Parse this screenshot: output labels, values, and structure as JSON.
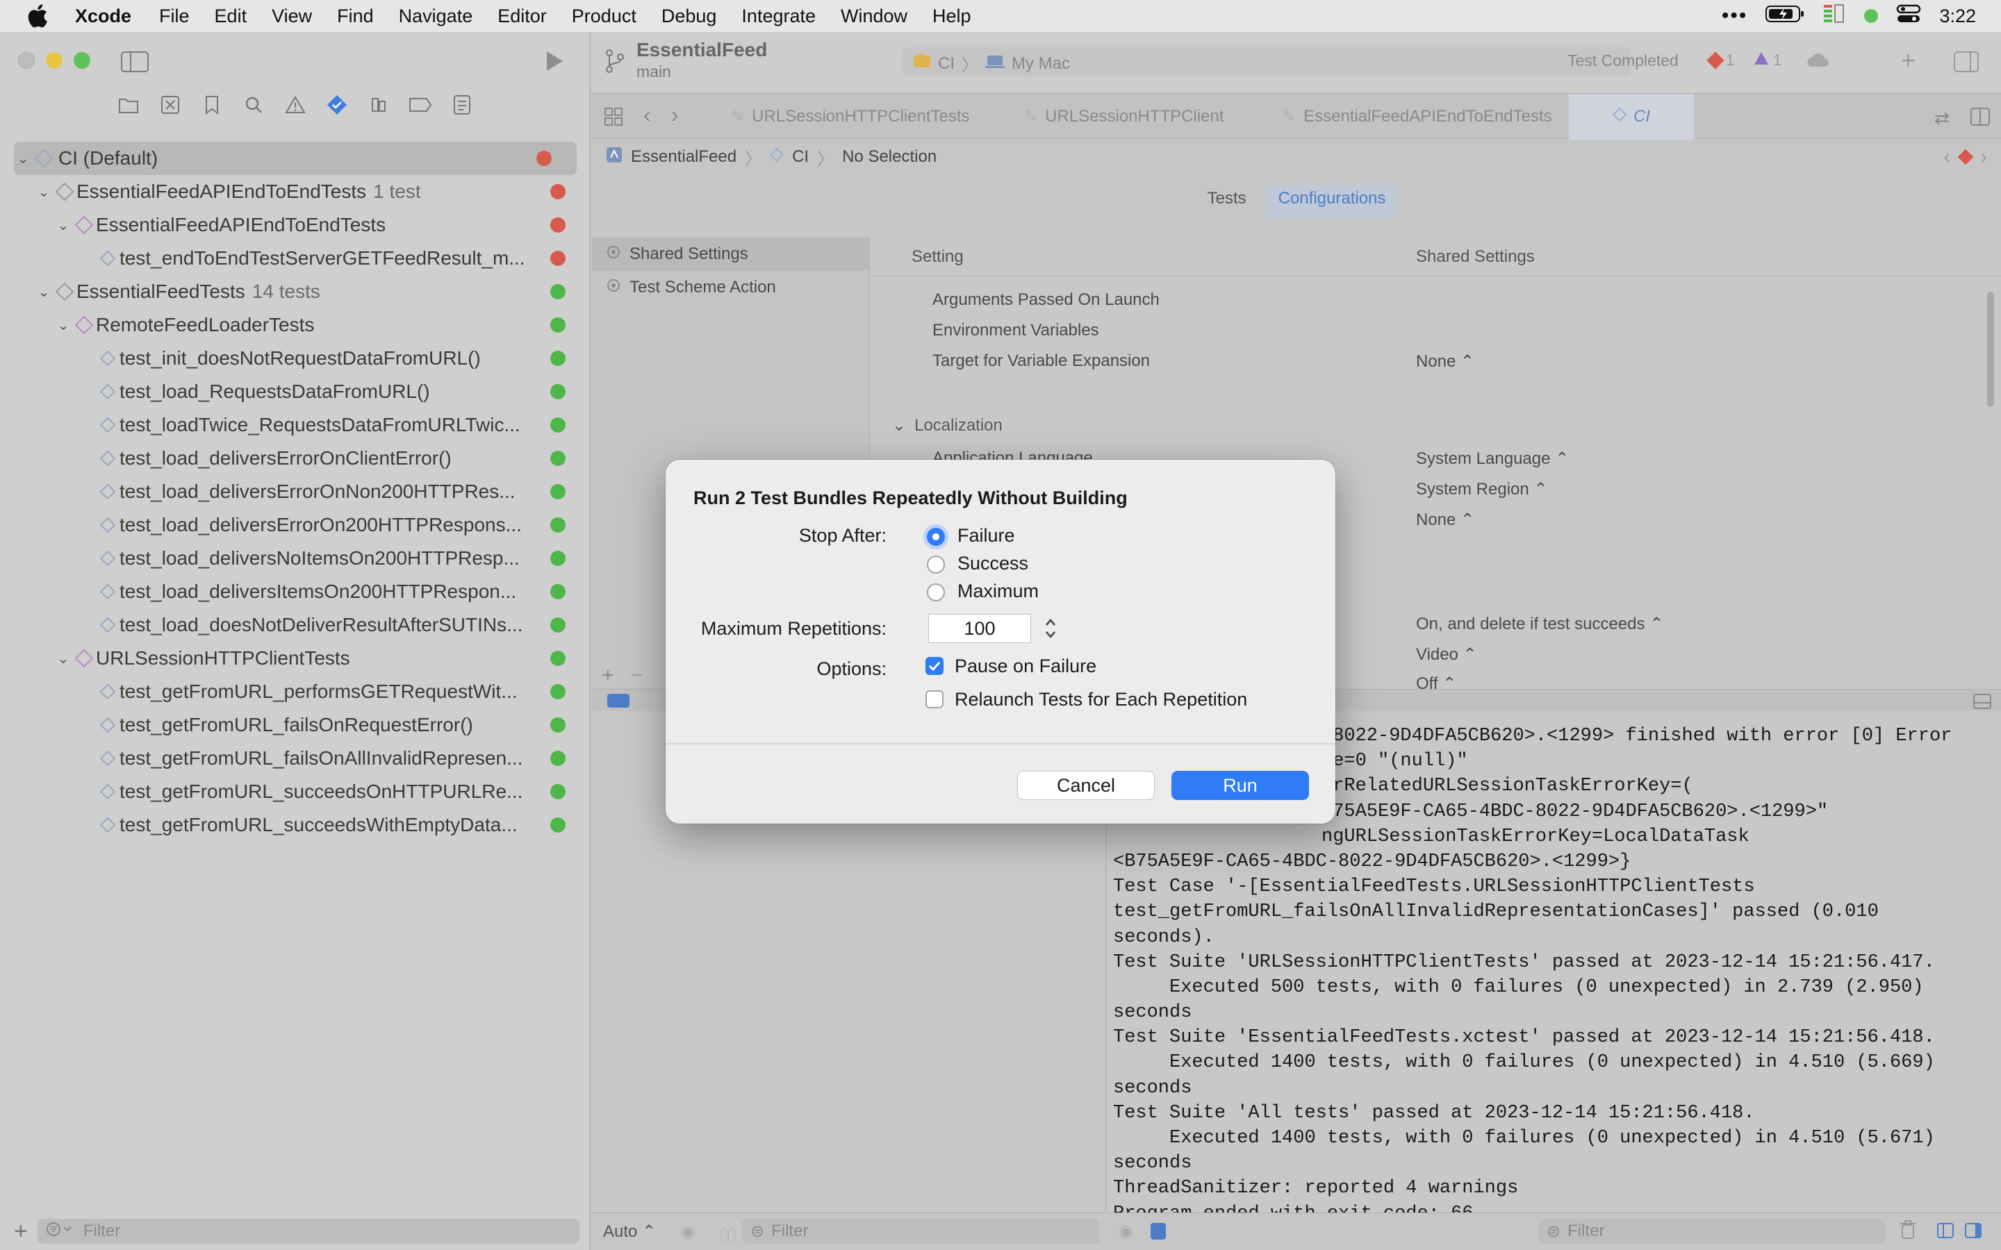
{
  "menubar": {
    "app": "Xcode",
    "items": [
      "File",
      "Edit",
      "View",
      "Find",
      "Navigate",
      "Editor",
      "Product",
      "Debug",
      "Integrate",
      "Window",
      "Help"
    ],
    "clock": "3:22"
  },
  "toolbar": {
    "project": "EssentialFeed",
    "branch": "main",
    "scheme": "CI",
    "destination": "My Mac",
    "status": "Test Completed",
    "errors": "1",
    "warnings": "1"
  },
  "navigator": {
    "rows": [
      {
        "label": "CI (Default)",
        "count": "",
        "status": "fail"
      },
      {
        "label": "EssentialFeedAPIEndToEndTests",
        "count": "1 test",
        "status": "fail"
      },
      {
        "label": "EssentialFeedAPIEndToEndTests",
        "count": "",
        "status": "fail"
      },
      {
        "label": "test_endToEndTestServerGETFeedResult_m...",
        "count": "",
        "status": "fail"
      },
      {
        "label": "EssentialFeedTests",
        "count": "14 tests",
        "status": "pass"
      },
      {
        "label": "RemoteFeedLoaderTests",
        "count": "",
        "status": "pass"
      },
      {
        "label": "test_init_doesNotRequestDataFromURL()",
        "count": "",
        "status": "pass"
      },
      {
        "label": "test_load_RequestsDataFromURL()",
        "count": "",
        "status": "pass"
      },
      {
        "label": "test_loadTwice_RequestsDataFromURLTwic...",
        "count": "",
        "status": "pass"
      },
      {
        "label": "test_load_deliversErrorOnClientError()",
        "count": "",
        "status": "pass"
      },
      {
        "label": "test_load_deliversErrorOnNon200HTTPRes...",
        "count": "",
        "status": "pass"
      },
      {
        "label": "test_load_deliversErrorOn200HTTPRespons...",
        "count": "",
        "status": "pass"
      },
      {
        "label": "test_load_deliversNoItemsOn200HTTPResp...",
        "count": "",
        "status": "pass"
      },
      {
        "label": "test_load_deliversItemsOn200HTTPRespon...",
        "count": "",
        "status": "pass"
      },
      {
        "label": "test_load_doesNotDeliverResultAfterSUTINs...",
        "count": "",
        "status": "pass"
      },
      {
        "label": "URLSessionHTTPClientTests",
        "count": "",
        "status": "pass"
      },
      {
        "label": "test_getFromURL_performsGETRequestWit...",
        "count": "",
        "status": "pass"
      },
      {
        "label": "test_getFromURL_failsOnRequestError()",
        "count": "",
        "status": "pass"
      },
      {
        "label": "test_getFromURL_failsOnAllInvalidRepresen...",
        "count": "",
        "status": "pass"
      },
      {
        "label": "test_getFromURL_succeedsOnHTTPURLRe...",
        "count": "",
        "status": "pass"
      },
      {
        "label": "test_getFromURL_succeedsWithEmptyData...",
        "count": "",
        "status": "pass"
      }
    ],
    "filter_placeholder": "Filter"
  },
  "tabs": [
    "URLSessionHTTPClientTests",
    "URLSessionHTTPClient",
    "EssentialFeedAPIEndToEndTests",
    "CI"
  ],
  "jumpbar": [
    "EssentialFeed",
    "CI",
    "No Selection"
  ],
  "segments": [
    "Tests",
    "Configurations"
  ],
  "test_sidebar": [
    "Shared Settings",
    "Test Scheme Action"
  ],
  "settings": {
    "col_setting": "Setting",
    "col_shared": "Shared Settings",
    "rows": [
      {
        "key": "Arguments Passed On Launch",
        "value": ""
      },
      {
        "key": "Environment Variables",
        "value": ""
      },
      {
        "key": "Target for Variable Expansion",
        "value": "None ⌃"
      },
      {
        "key": "Localization",
        "value": ""
      },
      {
        "key": "Application Language",
        "value": "System Language ⌃"
      },
      {
        "key": "Application Region",
        "value": "System Region ⌃"
      },
      {
        "key": "",
        "value": "None ⌃"
      },
      {
        "key": "",
        "value": "On, and delete if test succeeds ⌃"
      },
      {
        "key": "",
        "value": "Video ⌃"
      },
      {
        "key": "",
        "value": "Off ⌃"
      }
    ]
  },
  "console": [
    "-8022-9D4DFA5CB620>.<1299> finished with error [0] Error",
    "le=0 \"(null)\"",
    "orRelatedURLSessionTaskErrorKey=(",
    "B75A5E9F-CA65-4BDC-8022-9D4DFA5CB620>.<1299>\"",
    "ngURLSessionTaskErrorKey=LocalDataTask",
    "<B75A5E9F-CA65-4BDC-8022-9D4DFA5CB620>.<1299>}",
    "Test Case '-[EssentialFeedTests.URLSessionHTTPClientTests",
    "test_getFromURL_failsOnAllInvalidRepresentationCases]' passed (0.010",
    "seconds).",
    "Test Suite 'URLSessionHTTPClientTests' passed at 2023-12-14 15:21:56.417.",
    "     Executed 500 tests, with 0 failures (0 unexpected) in 2.739 (2.950)",
    "seconds",
    "Test Suite 'EssentialFeedTests.xctest' passed at 2023-12-14 15:21:56.418.",
    "     Executed 1400 tests, with 0 failures (0 unexpected) in 4.510 (5.669)",
    "seconds",
    "Test Suite 'All tests' passed at 2023-12-14 15:21:56.418.",
    "     Executed 1400 tests, with 0 failures (0 unexpected) in 4.510 (5.671)",
    "seconds",
    "ThreadSanitizer: reported 4 warnings",
    "Program ended with exit code: 66"
  ],
  "editor_bottom": {
    "auto": "Auto ⌃",
    "filter_placeholder": "Filter"
  },
  "dialog": {
    "title": "Run 2 Test Bundles Repeatedly Without Building",
    "stop_after_label": "Stop After:",
    "stop_options": [
      "Failure",
      "Success",
      "Maximum"
    ],
    "selected_stop": "Failure",
    "max_reps_label": "Maximum Repetitions:",
    "max_reps_value": "100",
    "options_label": "Options:",
    "option_pause": "Pause on Failure",
    "option_pause_checked": true,
    "option_relaunch": "Relaunch Tests for Each Repetition",
    "option_relaunch_checked": false,
    "cancel": "Cancel",
    "run": "Run"
  },
  "colors": {
    "accent": "#2f7cf6",
    "fail": "#d85a4c",
    "pass": "#4fb64a"
  }
}
